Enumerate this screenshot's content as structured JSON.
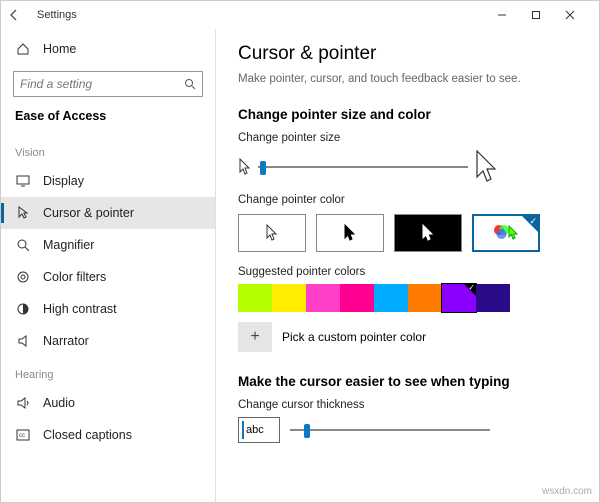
{
  "window": {
    "title": "Settings"
  },
  "sidebar": {
    "home": "Home",
    "search_placeholder": "Find a setting",
    "category": "Ease of Access",
    "group_vision": "Vision",
    "group_hearing": "Hearing",
    "items": {
      "display": "Display",
      "cursor": "Cursor & pointer",
      "magnifier": "Magnifier",
      "color_filters": "Color filters",
      "high_contrast": "High contrast",
      "narrator": "Narrator",
      "audio": "Audio",
      "closed_captions": "Closed captions"
    }
  },
  "main": {
    "title": "Cursor & pointer",
    "subtitle": "Make pointer, cursor, and touch feedback easier to see.",
    "section_size_color": "Change pointer size and color",
    "label_pointer_size": "Change pointer size",
    "label_pointer_color": "Change pointer color",
    "label_suggested": "Suggested pointer colors",
    "custom_color": "Pick a custom pointer color",
    "section_cursor": "Make the cursor easier to see when typing",
    "label_thickness": "Change cursor thickness",
    "abc": "abc"
  },
  "suggested_colors": [
    "#b3ff00",
    "#ffee00",
    "#ff3ec9",
    "#ff0090",
    "#00aaff",
    "#ff7a00",
    "#8a00ff",
    "#2b0a8a"
  ],
  "watermark": "wsxdn.com"
}
